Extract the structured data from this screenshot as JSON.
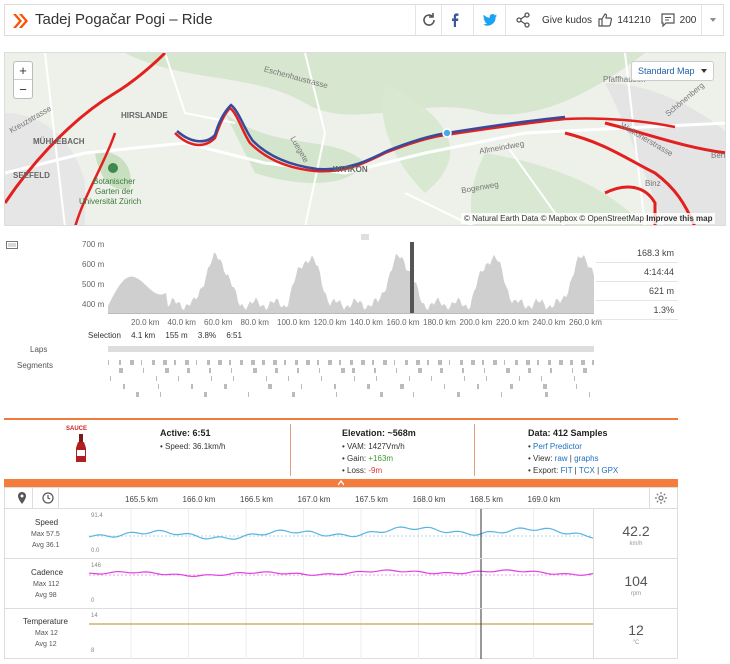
{
  "header": {
    "title": "Tadej Pogačar Pogi – Ride",
    "give_kudos": "Give kudos",
    "kudos_count": "141210",
    "comment_count": "200"
  },
  "map": {
    "zoom_in": "+",
    "zoom_out": "−",
    "map_type": "Standard Map",
    "attribution": "© Natural Earth Data © Mapbox © OpenStreetMap",
    "attribution_link": "Improve this map",
    "labels": {
      "hirslanden": "HIRSLANDE",
      "muehlebach": "MÜHLEBACH",
      "seefeld": "SEEFELD",
      "garden1": "Botanischer",
      "garden2": "Garten der",
      "garden3": "Universität Zürich",
      "witikon": "WITIKON",
      "pfaffhausen": "Pfaffhausen",
      "binz": "Binz",
      "ben": "Ben",
      "kreuzstrasse": "Kreuzstrasse",
      "eschenhaustrasse": "Eschenhaustrasse",
      "allmeindweg": "Allmeindweg",
      "bogenweg": "Bogenweg",
      "loorenstrasse": "Loorenstrasse",
      "schoenenberg": "Schönenberg",
      "wittikonerstrasse": "Witikonerstrasse",
      "luegete": "Luegete"
    }
  },
  "elevation": {
    "y_ticks": [
      "700 m",
      "600 m",
      "500 m",
      "400 m"
    ],
    "x_ticks": [
      "20.0 km",
      "40.0 km",
      "60.0 km",
      "80.0 km",
      "100.0 km",
      "120.0 km",
      "140.0 km",
      "160.0 km",
      "180.0 km",
      "200.0 km",
      "220.0 km",
      "240.0 km",
      "260.0 km"
    ],
    "stats": [
      "168.3 km",
      "4:14:44",
      "621 m",
      "1.3%"
    ],
    "selection_label": "Selection",
    "selection_values": [
      "4.1 km",
      "155 m",
      "3.8%",
      "6:51"
    ],
    "laps_label": "Laps",
    "segments_label": "Segments"
  },
  "sauce": {
    "logo": "SAUCE",
    "active_title": "Active: 6:51",
    "speed_line": "• Speed: 36.1km/h",
    "elevation_title": "Elevation: ~568m",
    "vam_line": "• VAM: 1427Vm/h",
    "gain_label": "• Gain: ",
    "gain_value": "+163m",
    "loss_label": "• Loss: ",
    "loss_value": "-9m",
    "data_title": "Data: 412 Samples",
    "perf_predictor": "Perf Predictor",
    "view_label": "• View: ",
    "view_raw": "raw",
    "view_sep": " | ",
    "view_graphs": "graphs",
    "export_label": "• Export: ",
    "export_fit": "FIT",
    "export_tcx": "TCX",
    "export_gpx": "GPX",
    "pipe": " | "
  },
  "graphs": {
    "x_ticks": [
      "165.5 km",
      "166.0 km",
      "166.5 km",
      "167.0 km",
      "167.5 km",
      "168.0 km",
      "168.5 km",
      "169.0 km"
    ],
    "speed": {
      "name": "Speed",
      "max": "Max 57.5",
      "avg": "Avg 36.1",
      "ymax": "91.4",
      "ymin": "0.0",
      "value": "42.2",
      "unit": "km/h"
    },
    "cadence": {
      "name": "Cadence",
      "max": "Max 112",
      "avg": "Avg 98",
      "ymax": "146",
      "ymin": "0",
      "value": "104",
      "unit": "rpm"
    },
    "temperature": {
      "name": "Temperature",
      "max": "Max 12",
      "avg": "Avg 12",
      "ymax": "14",
      "ymin": "8",
      "value": "12",
      "unit": "°C"
    }
  },
  "colors": {
    "accent": "#f47c3c",
    "speed": "#5ab4e0",
    "cadence": "#e040e0",
    "temperature": "#c8a050",
    "route_blue": "#3a4a9a",
    "route_red": "#e32020"
  }
}
